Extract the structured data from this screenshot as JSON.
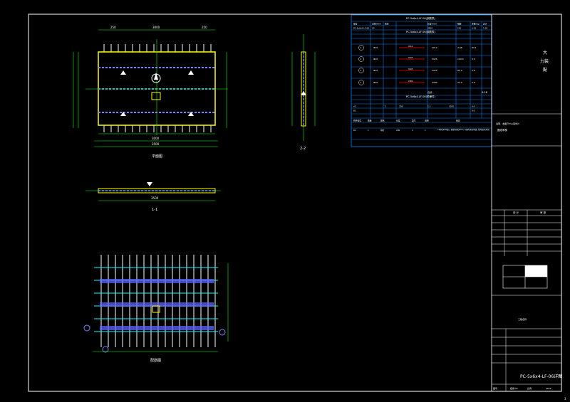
{
  "drawing": {
    "plan_title": "平面图",
    "section_1_title": "1-1",
    "section_2_title": "2-2",
    "rebar_title": "配筋图",
    "plan_overall_dim": "3500",
    "plan_mid_dim": "3000",
    "plan_left_dim": "250",
    "plan_right_dim": "250",
    "section_1_dim": "3500"
  },
  "rebar_table": {
    "title_1": "PC-5x6x4-LF-06(钢筋表)",
    "title_2": "PC-5x6x4-LF-06(钢筋表)",
    "title_3": "PC-5x6x4-LF-06(预埋件)",
    "header": [
      "编号",
      "直径(mm)",
      "形状",
      "长度(mm)",
      "根数",
      "重量(kg)",
      "总计"
    ],
    "row_top": [
      "PC-5x6x4-LF-06",
      "10",
      "",
      "3000",
      "150",
      "0.25",
      "1.00"
    ],
    "rows": [
      {
        "id": "1",
        "spec": "Φ10",
        "len": "2012",
        "count": "2.98",
        "wt": "64.1"
      },
      {
        "id": "2",
        "spec": "Φ10",
        "len": "3425",
        "count": "100.0",
        "wt": "4.0"
      },
      {
        "id": "3",
        "spec": "Φ10",
        "len": "3425",
        "count": "85.0",
        "wt": "4.8"
      },
      {
        "id": "4",
        "spec": "Φ10",
        "len": "2380",
        "count": "22.0",
        "wt": "4.8"
      }
    ],
    "total_label": "合计",
    "total_value": "4.18",
    "embed_rows": [
      [
        "A1",
        "2",
        "258",
        "5.3",
        "1200",
        "9.0"
      ],
      [
        "B1",
        "",
        "",
        "",
        "",
        "9.0"
      ]
    ],
    "bottom_header": [
      "构件编号",
      "数量",
      "规格",
      "长度",
      "型号",
      "说明",
      "备注"
    ],
    "bottom_row": [
      "D1",
      "1",
      "吊钉",
      "200",
      "1",
      "1"
    ],
    "note": "1.本构件采用C40混凝土，钢筋保护层厚度为20mm。2.预埋件位置详见平面图，吊装时应使用专用吊具。"
  },
  "title_block": {
    "company_line1": "大",
    "company_line2": "力装",
    "company_line3": "配",
    "drawing_note": "说明：本图尺寸以毫米计",
    "stamp_label": "图纸审核",
    "sign_rows": [
      "设 计",
      "审 核"
    ],
    "project_label": "工程名称",
    "drawing_name": "PC-5x6x4-LF-06详图",
    "scale_label": "比例",
    "scale_value": "1:25",
    "date_label": "日期",
    "date_value": "2022",
    "sheet_label": "图号",
    "sheet_value": "结施-01",
    "page_number": "1"
  },
  "colors": {
    "frame": "#ffffff",
    "panel": "#ffff00",
    "rebar": "#00ffff",
    "dims": "#00ff00",
    "table": "#0080ff",
    "magenta": "#8080ff",
    "red": "#ff0000"
  }
}
